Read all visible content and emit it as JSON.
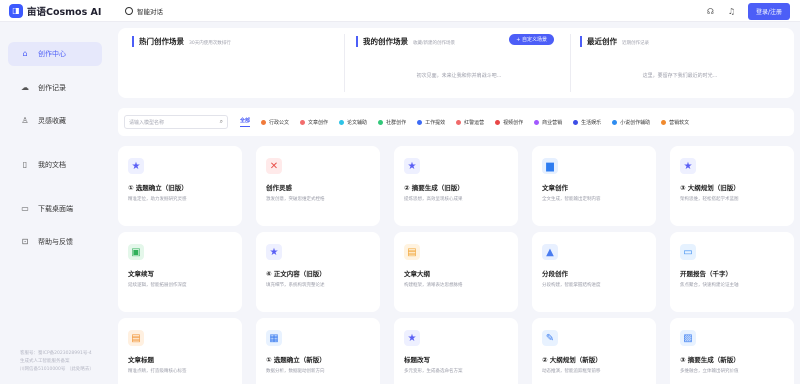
{
  "app": {
    "logo_text": "亩语Cosmos AI",
    "chat_tab": "智能对话",
    "login_label": "登录/注册"
  },
  "sidebar": {
    "items": [
      {
        "label": "创作中心",
        "icon": "home-icon"
      },
      {
        "label": "创作记录",
        "icon": "cloud-icon"
      },
      {
        "label": "灵感收藏",
        "icon": "bulb-icon"
      },
      {
        "label": "我的文档",
        "icon": "document-icon"
      },
      {
        "label": "下载桌面端",
        "icon": "monitor-icon"
      },
      {
        "label": "帮助与反馈",
        "icon": "help-icon"
      }
    ],
    "footer": [
      "客服号：蜀ICP备2023028991号-4",
      "生成式人工智能服务备案",
      "川网信备51010000号 （此处略去）"
    ]
  },
  "panels": {
    "hot": {
      "title": "热门创作场景",
      "subtitle": "30天内使用次数排行",
      "empty": ""
    },
    "mine": {
      "title": "我的创作场景",
      "subtitle": "收藏/新建的创作场景",
      "button": "+ 自定义场景",
      "empty": "初次见面，未来让我和你并肩战斗吧..."
    },
    "recent": {
      "title": "最近创作",
      "subtitle": "近期创作记录",
      "empty": "这里，要留存下我们最近的时光..."
    }
  },
  "search": {
    "placeholder": "请输入模型名称"
  },
  "categories": [
    {
      "label": "全部",
      "color": "",
      "active": true
    },
    {
      "label": "行政公文",
      "color": "#f07a3a"
    },
    {
      "label": "文章创作",
      "color": "#f26d6d"
    },
    {
      "label": "论文辅助",
      "color": "#2ec3e6"
    },
    {
      "label": "社群创作",
      "color": "#33c87a"
    },
    {
      "label": "工作提效",
      "color": "#3d6bf5"
    },
    {
      "label": "红警运营",
      "color": "#f06a6a"
    },
    {
      "label": "视频创作",
      "color": "#e84646"
    },
    {
      "label": "商业营销",
      "color": "#a259ff"
    },
    {
      "label": "生活娱乐",
      "color": "#3d4ee6"
    },
    {
      "label": "小说创作辅助",
      "color": "#2e8cf0"
    },
    {
      "label": "营销软文",
      "color": "#f08a2e"
    }
  ],
  "cards": [
    {
      "title": "① 选题确立（旧版）",
      "desc": "精准定位，助力发掘研究灵感",
      "icon": "star-icon",
      "bg": "#eef0ff",
      "glyph": "★",
      "color": "#5a5ff5"
    },
    {
      "title": "创作灵感",
      "desc": "激发创意，突破思维定式桎梏",
      "icon": "spark-icon",
      "bg": "#ffeaea",
      "glyph": "✕",
      "color": "#e8504a"
    },
    {
      "title": "② 摘要生成（旧版）",
      "desc": "提炼思想，高效呈现核心成果",
      "icon": "star-icon",
      "bg": "#eef0ff",
      "glyph": "★",
      "color": "#5a5ff5"
    },
    {
      "title": "文章创作",
      "desc": "全文生成，智能输出定制内容",
      "icon": "book-icon",
      "bg": "#e6f0ff",
      "glyph": "▆",
      "color": "#2e7cf0"
    },
    {
      "title": "③ 大纲规划（旧版）",
      "desc": "架构思维，轻松搭起学术蓝图",
      "icon": "star-icon",
      "bg": "#eef0ff",
      "glyph": "★",
      "color": "#5a5ff5"
    },
    {
      "title": "文章续写",
      "desc": "延续逻辑，智能拓展创作深度",
      "icon": "pen-icon",
      "bg": "#e4f7ea",
      "glyph": "▣",
      "color": "#2fb05a"
    },
    {
      "title": "④ 正文内容（旧版）",
      "desc": "填充细节，系统构筑完整论述",
      "icon": "star-icon",
      "bg": "#eef0ff",
      "glyph": "★",
      "color": "#5a5ff5"
    },
    {
      "title": "文章大纲",
      "desc": "构建框架，清晰表达思想脉络",
      "icon": "outline-icon",
      "bg": "#fff3e0",
      "glyph": "▤",
      "color": "#f0a02e"
    },
    {
      "title": "分段创作",
      "desc": "分段构建，智能掌握结构进度",
      "icon": "triangle-icon",
      "bg": "#e8f0ff",
      "glyph": "▲",
      "color": "#4a7cf0"
    },
    {
      "title": "开题报告（千字）",
      "desc": "焦点聚合，快速构建论证主轴",
      "icon": "report-icon",
      "bg": "#e6f2ff",
      "glyph": "▭",
      "color": "#3a8cf0"
    },
    {
      "title": "文章标题",
      "desc": "精准点睛，打造吸睛核心标签",
      "icon": "title-icon",
      "bg": "#fff0e0",
      "glyph": "▤",
      "color": "#f0902e"
    },
    {
      "title": "① 选题确立（新版）",
      "desc": "数据分析，数据驱动创新方向",
      "icon": "topic-icon",
      "bg": "#e8f2ff",
      "glyph": "▦",
      "color": "#3a7cf0"
    },
    {
      "title": "标题改写",
      "desc": "多元变形，生成备选命名方案",
      "icon": "star-icon",
      "bg": "#eef0ff",
      "glyph": "★",
      "color": "#5a5ff5"
    },
    {
      "title": "② 大纲规划（新版）",
      "desc": "动态推演，智能追踪框架前移",
      "icon": "plan-icon",
      "bg": "#e8f2ff",
      "glyph": "✎",
      "color": "#3a7cf0"
    },
    {
      "title": "③ 摘要生成（新版）",
      "desc": "多维融合，立体输出研究价值",
      "icon": "summary-icon",
      "bg": "#e8f2ff",
      "glyph": "▨",
      "color": "#3a7cf0"
    }
  ]
}
